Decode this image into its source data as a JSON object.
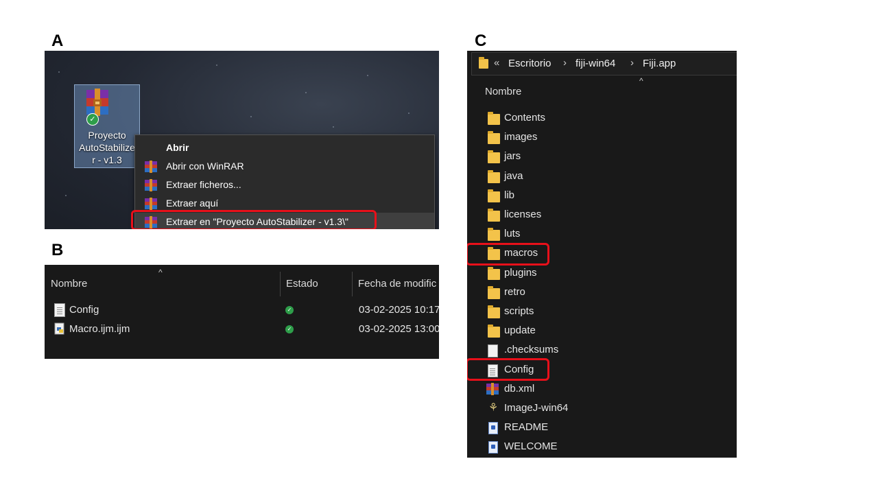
{
  "panel_labels": {
    "a": "A",
    "b": "B",
    "c": "C"
  },
  "panel_a": {
    "desktop_icon_label": "Proyecto AutoStabilize r - v1.3",
    "desktop_icon_lines": [
      "Proyecto",
      "AutoStabilize",
      "r - v1.3"
    ],
    "context_menu": [
      {
        "label": "Abrir",
        "bold": true,
        "icon": "none"
      },
      {
        "label": "Abrir con WinRAR",
        "icon": "winrar-icon"
      },
      {
        "label": "Extraer ficheros...",
        "icon": "winrar-icon"
      },
      {
        "label": "Extraer aquí",
        "icon": "winrar-icon"
      },
      {
        "label": "Extraer en \"Proyecto AutoStabilizer - v1.3\\\"",
        "icon": "winrar-icon",
        "highlighted": true
      }
    ]
  },
  "panel_b": {
    "columns": [
      "Nombre",
      "Estado",
      "Fecha de modific"
    ],
    "rows": [
      {
        "name": "Config",
        "icon": "text-file-icon",
        "status": "synced",
        "date": "03-02-2025 10:17"
      },
      {
        "name": "Macro.ijm.ijm",
        "icon": "python-script-icon",
        "status": "synced",
        "date": "03-02-2025 13:00"
      }
    ]
  },
  "panel_c": {
    "breadcrumb": {
      "overflow": "«",
      "items": [
        "Escritorio",
        "fiji-win64",
        "Fiji.app"
      ]
    },
    "column_header": "Nombre",
    "items": [
      {
        "name": "Contents",
        "type": "folder"
      },
      {
        "name": "images",
        "type": "folder"
      },
      {
        "name": "jars",
        "type": "folder"
      },
      {
        "name": "java",
        "type": "folder"
      },
      {
        "name": "lib",
        "type": "folder"
      },
      {
        "name": "licenses",
        "type": "folder"
      },
      {
        "name": "luts",
        "type": "folder"
      },
      {
        "name": "macros",
        "type": "folder",
        "highlighted": true
      },
      {
        "name": "plugins",
        "type": "folder"
      },
      {
        "name": "retro",
        "type": "folder"
      },
      {
        "name": "scripts",
        "type": "folder"
      },
      {
        "name": "update",
        "type": "folder"
      },
      {
        "name": ".checksums",
        "type": "file"
      },
      {
        "name": "Config",
        "type": "text-file",
        "highlighted": true
      },
      {
        "name": "db.xml",
        "type": "winrar-file"
      },
      {
        "name": "ImageJ-win64",
        "type": "executable"
      },
      {
        "name": "README",
        "type": "readme"
      },
      {
        "name": "WELCOME",
        "type": "readme"
      }
    ]
  },
  "colors": {
    "highlight_box": "#e8101a",
    "folder": "#f3c34a",
    "status_ok": "#2e9e4a",
    "explorer_bg": "#191919"
  }
}
